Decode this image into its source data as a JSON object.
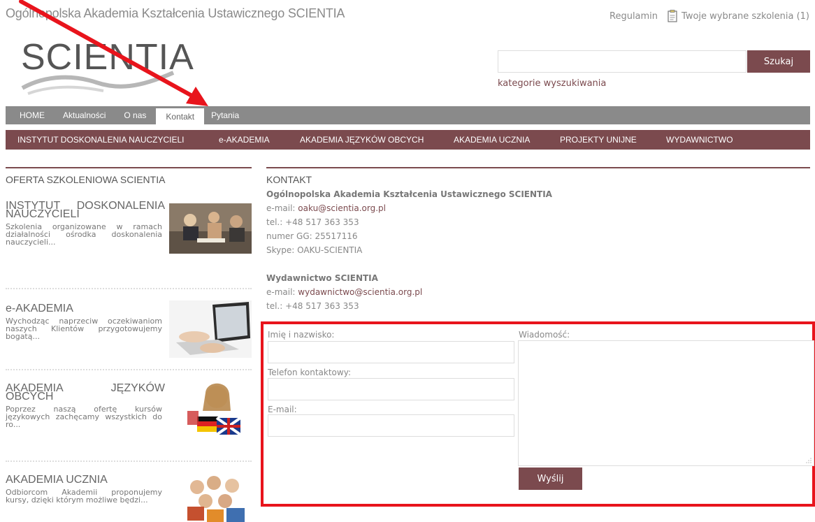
{
  "header": {
    "site_title": "Ogólnopolska Akademia Kształcenia Ustawicznego SCIENTIA",
    "logo_text": "SCIENTIA",
    "top_links": {
      "regulamin": "Regulamin",
      "favorites": "Twoje wybrane szkolenia (1)"
    },
    "search": {
      "value": "",
      "button_label": "Szukaj",
      "categories_link": "kategorie wyszukiwania"
    }
  },
  "nav_main": {
    "items": [
      "HOME",
      "Aktualności",
      "O nas",
      "Kontakt",
      "Pytania"
    ],
    "active": "Kontakt"
  },
  "nav_sections": {
    "items": [
      "INSTYTUT DOSKONALENIA NAUCZYCIELI",
      "e-AKADEMIA",
      "AKADEMIA JĘZYKÓW OBCYCH",
      "AKADEMIA UCZNIA",
      "PROJEKTY UNIJNE",
      "WYDAWNICTWO"
    ]
  },
  "left": {
    "heading": "OFERTA SZKOLENIOWA SCIENTIA",
    "offers": [
      {
        "title": "INSTYTUT DOSKONALENIA NAUCZYCIELI",
        "text": "Szkolenia organizowane w ramach działalności ośrodka doskonalenia nauczycieli..."
      },
      {
        "title": "e-AKADEMIA",
        "text": "Wychodząc naprzeciw oczekiwaniom naszych Klientów przygotowujemy bogatą..."
      },
      {
        "title": "AKADEMIA JĘZYKÓW OBCYCH",
        "text": "Poprzez naszą ofertę kursów językowych zachęcamy wszystkich do ro..."
      },
      {
        "title": "AKADEMIA UCZNIA",
        "text": "Odbiorcom Akademii proponujemy kursy, dzięki którym możliwe będzi..."
      }
    ]
  },
  "contact": {
    "heading": "KONTAKT",
    "org_name": "Ogólnopolska Akademia Kształcenia Ustawicznego SCIENTIA",
    "email_label": "e-mail:",
    "email": "oaku@scientia.org.pl",
    "phone": "tel.: +48 517 363 353",
    "gg": "numer GG: 25517116",
    "skype": "Skype: OAKU-SCIENTIA",
    "pub_name": "Wydawnictwo SCIENTIA",
    "pub_email_label": "e-mail:",
    "pub_email": "wydawnictwo@scientia.org.pl",
    "pub_phone": "tel.: +48 517 363 353"
  },
  "form": {
    "name_label": "Imię i nazwisko:",
    "phone_label": "Telefon kontaktowy:",
    "email_label": "E-mail:",
    "message_label": "Wiadomość:",
    "submit_label": "Wyślij"
  },
  "colors": {
    "accent": "#7b4a4e",
    "nav_gray": "#8a8a8a",
    "highlight_red": "#e8141c"
  }
}
